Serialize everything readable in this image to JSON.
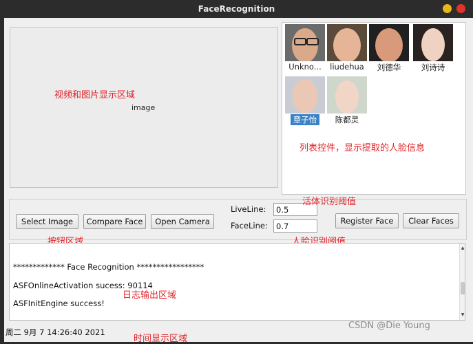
{
  "window": {
    "title": "FaceRecognition"
  },
  "image_area": {
    "placeholder": "image",
    "annotation": "视频和图片显示区域"
  },
  "face_list": {
    "annotation": "列表控件，显示提取的人脸信息",
    "items": [
      {
        "name": "Unkno...",
        "selected": false
      },
      {
        "name": "liudehua",
        "selected": false
      },
      {
        "name": "刘德华",
        "selected": false
      },
      {
        "name": "刘诗诗",
        "selected": false
      },
      {
        "name": "章子怡",
        "selected": true
      },
      {
        "name": "陈都灵",
        "selected": false
      }
    ]
  },
  "controls": {
    "select_image": "Select Image",
    "compare_face": "Compare Face",
    "open_camera": "Open Camera",
    "liveline_label": "LiveLine:",
    "liveline_value": "0.5",
    "faceline_label": "FaceLine:",
    "faceline_value": "0.7",
    "register_face": "Register Face",
    "clear_faces": "Clear Faces",
    "ann_buttons": "按钮区域",
    "ann_live": "活体识别阈值",
    "ann_face": "人脸识别阈值"
  },
  "log": {
    "lines": [
      "************* Face Recognition *****************",
      "ASFOnlineActivation sucess: 90114",
      "ASFInitEngine success!"
    ],
    "annotation": "日志输出区域"
  },
  "status": {
    "datetime": "周二 9月 7 14:26:40 2021",
    "annotation": "时间显示区域"
  },
  "watermark": "CSDN @Die Young",
  "colors": {
    "annotation": "#e0242a",
    "selection": "#3a82c8",
    "close": "#e0332b",
    "minimize": "#e8b71a"
  }
}
